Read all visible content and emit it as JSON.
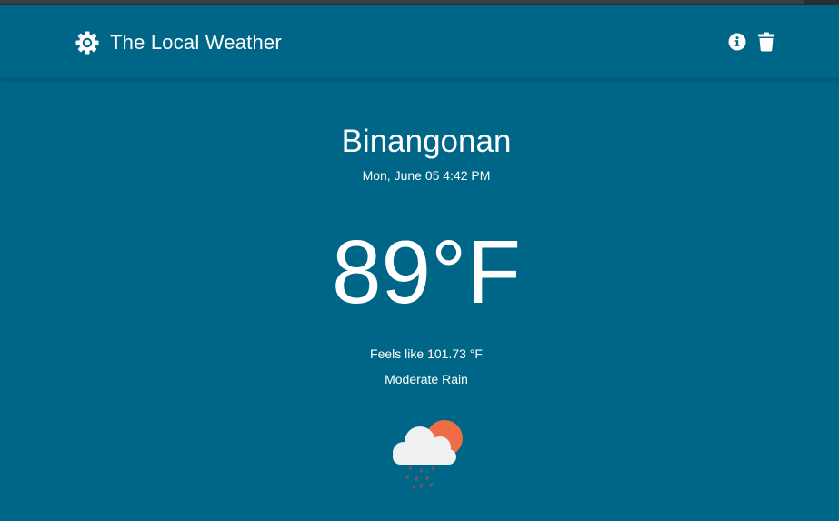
{
  "app": {
    "title": "The Local Weather"
  },
  "header": {
    "logo_icon": "gear-icon",
    "info_icon": "info-circle-icon",
    "delete_icon": "trash-icon"
  },
  "weather": {
    "city": "Binangonan",
    "datetime": "Mon, June 05 4:42 PM",
    "temperature": "89°F",
    "feels_like": "Feels like 101.73 °F",
    "condition": "Moderate Rain",
    "condition_icon": "cloud-sun-rain-icon"
  },
  "colors": {
    "background": "#006687",
    "sun": "#ee6d47",
    "cloud": "#eef0f2",
    "rain": "#595e66"
  }
}
